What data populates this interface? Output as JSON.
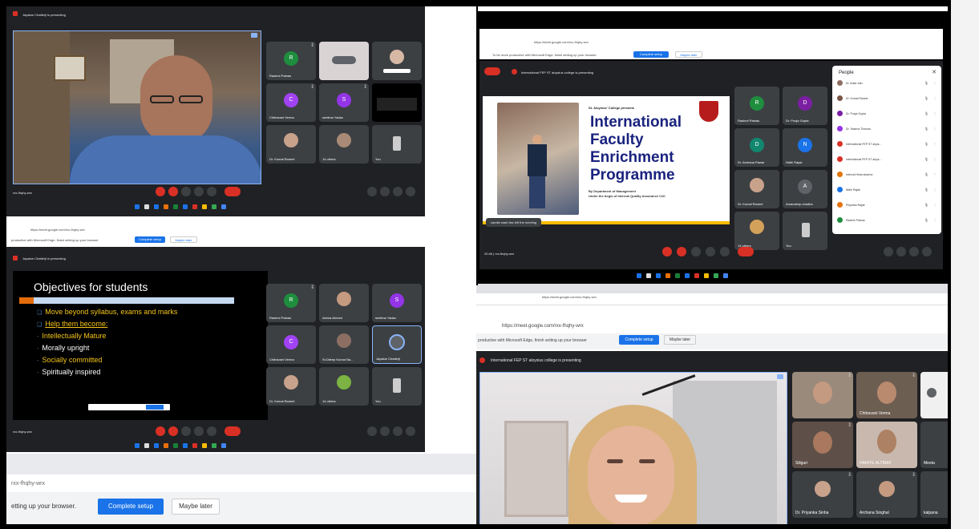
{
  "top_left": {
    "presenting": "Jayakar Chatterji is presenting",
    "meeting_code": "rxx-fhqhy-wrx",
    "tiles": [
      {
        "initial": "R",
        "name": "Rashmi Patnas",
        "color": "#1e8e3e"
      },
      {
        "initial": "",
        "name": "",
        "color": ""
      },
      {
        "initial": "",
        "name": "",
        "color": ""
      },
      {
        "initial": "C",
        "name": "Chitravani Verma",
        "color": "#a142f4"
      },
      {
        "initial": "S",
        "name": "seelima Yadav",
        "color": "#9334e6"
      },
      {
        "initial": "",
        "name": "",
        "color": ""
      },
      {
        "initial": "",
        "name": "Dr. Komal Raneel",
        "color": ""
      },
      {
        "initial": "",
        "name": "14 others",
        "color": ""
      },
      {
        "initial": "",
        "name": "You",
        "color": ""
      }
    ]
  },
  "mid_left": {
    "browser_url": "https://meet.google.com/rxx-fhqhy-wrx",
    "edge_prompt": "productive with Microsoft Edge, finish setting up your browser",
    "complete_setup": "Complete setup",
    "maybe_later": "Maybe later",
    "presenting": "Jayakar Chatterji is presenting",
    "meeting_code": "rxx-fhqhy-wrx",
    "slide": {
      "title": "Objectives for students",
      "lines": [
        {
          "text": "Move beyond syllabus, exams and marks",
          "color": "#f5c518",
          "bullet": "❑"
        },
        {
          "text": "Help them become:",
          "color": "#f5c518",
          "bullet": "❑"
        },
        {
          "text": "Intellectually Mature",
          "color": "#f5c518",
          "bullet": "-"
        },
        {
          "text": "Morally upright",
          "color": "#ffffff",
          "bullet": "-"
        },
        {
          "text": "Socially committed",
          "color": "#f5c518",
          "bullet": "-"
        },
        {
          "text": "Spiritually inspired",
          "color": "#ffffff",
          "bullet": "-"
        }
      ]
    },
    "tiles": [
      {
        "initial": "R",
        "name": "Rashmi Patnas",
        "color": "#1e8e3e"
      },
      {
        "initial": "",
        "name": "Ashna Ahmed",
        "color": ""
      },
      {
        "initial": "S",
        "name": "seelima Yadav",
        "color": "#9334e6"
      },
      {
        "initial": "C",
        "name": "Chitravani Verma",
        "color": "#a142f4"
      },
      {
        "initial": "",
        "name": "Sr.Dileep Kumar Ba...",
        "color": ""
      },
      {
        "initial": "",
        "name": "Jayakar Chatterji",
        "color": ""
      },
      {
        "initial": "",
        "name": "Dr. Komal Raneel",
        "color": ""
      },
      {
        "initial": "",
        "name": "14 others",
        "color": ""
      },
      {
        "initial": "",
        "name": "You",
        "color": ""
      }
    ]
  },
  "bottom_left": {
    "code": "rxx-fhqhy-wrx",
    "prompt": "etting up your browser.",
    "complete_setup": "Complete setup",
    "maybe_later": "Maybe later"
  },
  "top_right": {
    "url": "https://meet.google.com/rxx-fhqhy-wrx",
    "edge_prompt": "To be more productive with Microsoft Edge, finish setting up your browser",
    "complete_setup": "Complete setup",
    "maybe_later": "Maybe later",
    "presenting": "International FEP ST aloysius college is presenting",
    "time_code": "20:46 | rxx-fhqhy-wrx",
    "left_notice": "candle want few left the meeting",
    "slide": {
      "presents": "St. Aloysius' College presents",
      "title_lines": [
        "International",
        "Faculty",
        "Enrichment",
        "Programme"
      ],
      "by": "By Department of Management",
      "under": "Under the Aegis of Internal Quality Assurance Cell"
    },
    "tiles": [
      {
        "initial": "R",
        "name": "Rashmi Patnas",
        "color": "#1e8e3e"
      },
      {
        "initial": "D",
        "name": "Dr. Pooja Gupta",
        "color": "#7b1fa2"
      },
      {
        "initial": "D",
        "name": "Dr. Archana Pawar",
        "color": "#12876f"
      },
      {
        "initial": "N",
        "name": "Nidhi Rajak",
        "color": "#1a73e8"
      },
      {
        "initial": "",
        "name": "Dr. Komal Raneel",
        "color": ""
      },
      {
        "initial": "A",
        "name": "Amandeep chadha",
        "color": "#5f6368"
      },
      {
        "initial": "",
        "name": "14 others",
        "color": ""
      },
      {
        "initial": "",
        "name": "You",
        "color": ""
      }
    ],
    "people": {
      "title": "People",
      "list": [
        {
          "name": "Dr. Anita Jain",
          "color": "#8d6e63"
        },
        {
          "name": "Dr. Komal Raneel",
          "color": "#795548"
        },
        {
          "name": "Dr. Pooja Gupta",
          "color": "#7b1fa2"
        },
        {
          "name": "Dr. Swarna Thomas",
          "color": "#9334e6"
        },
        {
          "name": "International FEP ST aloys...",
          "color": "#d93025"
        },
        {
          "name": "International FEP ST aloys...",
          "color": "#d93025"
        },
        {
          "name": "Interval Hima sharma",
          "color": "#e37400"
        },
        {
          "name": "Nidhi Rajak",
          "color": "#1a73e8"
        },
        {
          "name": "Priyanka Rajak",
          "color": "#e8710a"
        },
        {
          "name": "Rashmi Patnas",
          "color": "#1e8e3e"
        }
      ]
    }
  },
  "bottom_right": {
    "url": "https://meet.google.com/rxx-fhqhy-wrx",
    "edge_prompt": "productive with Microsoft Edge, finish setting up your browser",
    "complete_setup": "Complete setup",
    "maybe_later": "Maybe later",
    "presenting": "International FEP ST aloysius college is presenting",
    "tiles": [
      {
        "name": ""
      },
      {
        "name": "Chitravani Verma"
      },
      {
        "name": ""
      },
      {
        "name": "Siliguri"
      },
      {
        "name": "HANIYE ALTINAY"
      },
      {
        "name": "Meeta"
      },
      {
        "name": "Dr. Priyanka Sinha"
      },
      {
        "name": "Archana Singhal"
      },
      {
        "name": "kalpana"
      }
    ]
  },
  "colors": {
    "meet_bg": "#202124",
    "tile_bg": "#3c4043",
    "red": "#d93025",
    "blue": "#1a73e8"
  }
}
